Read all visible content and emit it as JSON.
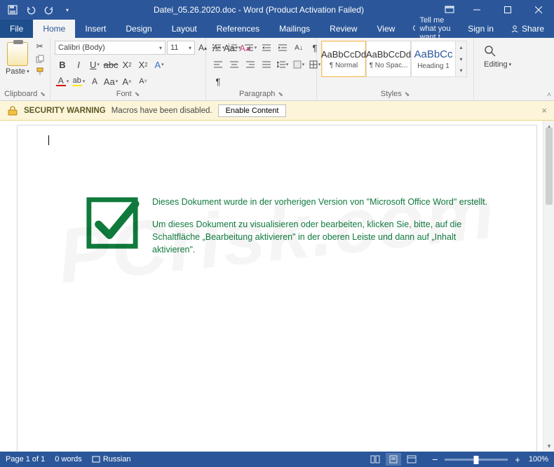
{
  "titlebar": {
    "title": "Datei_05.26.2020.doc - Word (Product Activation Failed)"
  },
  "tabs": {
    "file": "File",
    "home": "Home",
    "insert": "Insert",
    "design": "Design",
    "layout": "Layout",
    "references": "References",
    "mailings": "Mailings",
    "review": "Review",
    "view": "View",
    "tell": "Tell me what you want t",
    "signin": "Sign in",
    "share": "Share"
  },
  "ribbon": {
    "clipboard": {
      "label": "Clipboard",
      "paste": "Paste"
    },
    "font": {
      "label": "Font",
      "name": "Calibri (Body)",
      "size": "11"
    },
    "paragraph": {
      "label": "Paragraph"
    },
    "styles": {
      "label": "Styles",
      "preview": "AaBbCcDd",
      "preview3": "AaBbCc",
      "s1": "¶ Normal",
      "s2": "¶ No Spac...",
      "s3": "Heading 1"
    },
    "editing": {
      "label": "Editing"
    }
  },
  "security": {
    "title": "SECURITY WARNING",
    "msg": "Macros have been disabled.",
    "btn": "Enable Content"
  },
  "document": {
    "p1": "Dieses Dokument wurde in der vorherigen Version von \"Microsoft Office Word\" erstellt.",
    "p2": "Um dieses Dokument zu visualisieren oder bearbeiten, klicken Sie, bitte, auf die Schaltfläche „Bearbeitung aktivieren\" in der oberen Leiste und dann auf „Inhalt aktivieren\"."
  },
  "status": {
    "page": "Page 1 of 1",
    "words": "0 words",
    "lang": "Russian",
    "zoom": "100%"
  },
  "watermark": "PCrisk.com"
}
